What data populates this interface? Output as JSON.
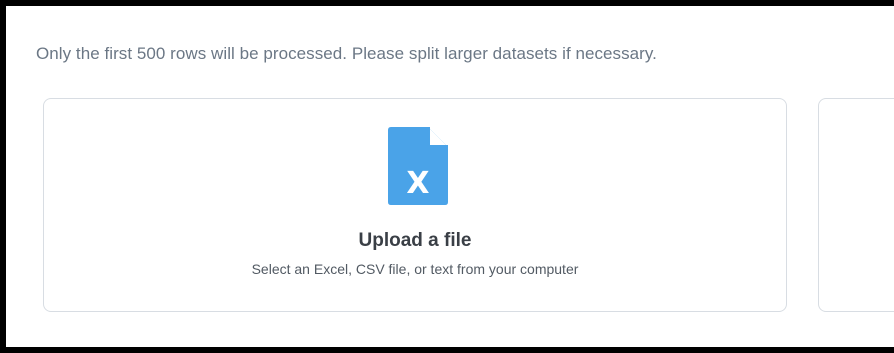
{
  "notice": {
    "text": "Only the first 500 rows will be processed. Please split larger datasets if necessary."
  },
  "upload_card": {
    "icon": "excel-file-icon",
    "icon_letter": "X",
    "title": "Upload a file",
    "subtitle": "Select an Excel, CSV file, or text from your computer"
  },
  "colors": {
    "frame_border": "#000000",
    "notice_text": "#6b7785",
    "card_border": "#d8dde3",
    "icon_fill": "#4aa3e8",
    "title_text": "#3a3f46",
    "subtitle_text": "#525a63"
  }
}
